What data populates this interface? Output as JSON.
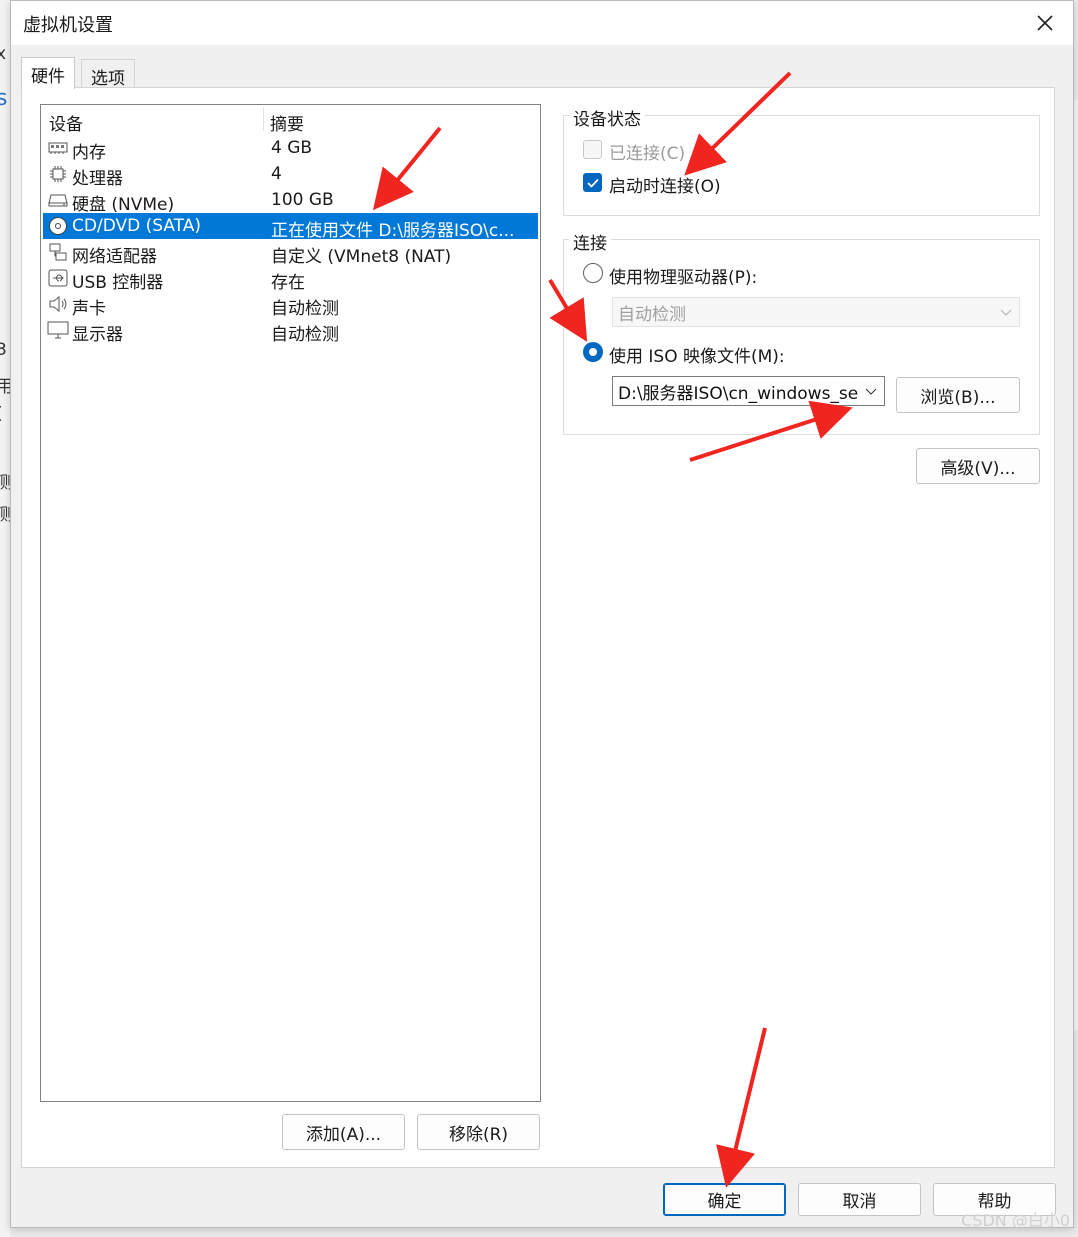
{
  "background": {
    "glyphs": [
      "x",
      "s",
      "3",
      "用",
      "(",
      "测",
      "测"
    ]
  },
  "window": {
    "title": "虚拟机设置",
    "close_icon": "close-icon"
  },
  "tabs": [
    {
      "label": "硬件",
      "active": true
    },
    {
      "label": "选项",
      "active": false
    }
  ],
  "device_list": {
    "columns": [
      "设备",
      "摘要"
    ],
    "rows": [
      {
        "icon": "memory-icon",
        "device": "内存",
        "summary": "4 GB",
        "selected": false
      },
      {
        "icon": "processor-icon",
        "device": "处理器",
        "summary": "4",
        "selected": false
      },
      {
        "icon": "disk-icon",
        "device": "硬盘 (NVMe)",
        "summary": "100 GB",
        "selected": false
      },
      {
        "icon": "cd-dvd-icon",
        "device": "CD/DVD (SATA)",
        "summary": "正在使用文件 D:\\服务器ISO\\c...",
        "selected": true
      },
      {
        "icon": "network-adapter-icon",
        "device": "网络适配器",
        "summary": "自定义 (VMnet8 (NAT)",
        "selected": false
      },
      {
        "icon": "usb-icon",
        "device": "USB 控制器",
        "summary": "存在",
        "selected": false
      },
      {
        "icon": "sound-icon",
        "device": "声卡",
        "summary": "自动检测",
        "selected": false
      },
      {
        "icon": "display-icon",
        "device": "显示器",
        "summary": "自动检测",
        "selected": false
      }
    ],
    "add_button": "添加(A)...",
    "remove_button": "移除(R)"
  },
  "device_status": {
    "title": "设备状态",
    "connected": {
      "label": "已连接(C)",
      "checked": false,
      "disabled": true
    },
    "connect_at_power_on": {
      "label": "启动时连接(O)",
      "checked": true,
      "disabled": false
    }
  },
  "connection": {
    "title": "连接",
    "physical": {
      "label": "使用物理驱动器(P):",
      "selected": false
    },
    "physical_select": {
      "value": "自动检测",
      "disabled": true
    },
    "iso": {
      "label": "使用 ISO 映像文件(M):",
      "selected": true
    },
    "iso_select": {
      "value": "D:\\服务器ISO\\cn_windows_se"
    },
    "browse_button": "浏览(B)..."
  },
  "advanced_button": "高级(V)...",
  "footer": {
    "ok": "确定",
    "cancel": "取消",
    "help": "帮助"
  },
  "watermark": "CSDN @白小0",
  "colors": {
    "selection": "#0078d7",
    "accent": "#0067c0",
    "annotation_arrow": "#f0251f"
  }
}
